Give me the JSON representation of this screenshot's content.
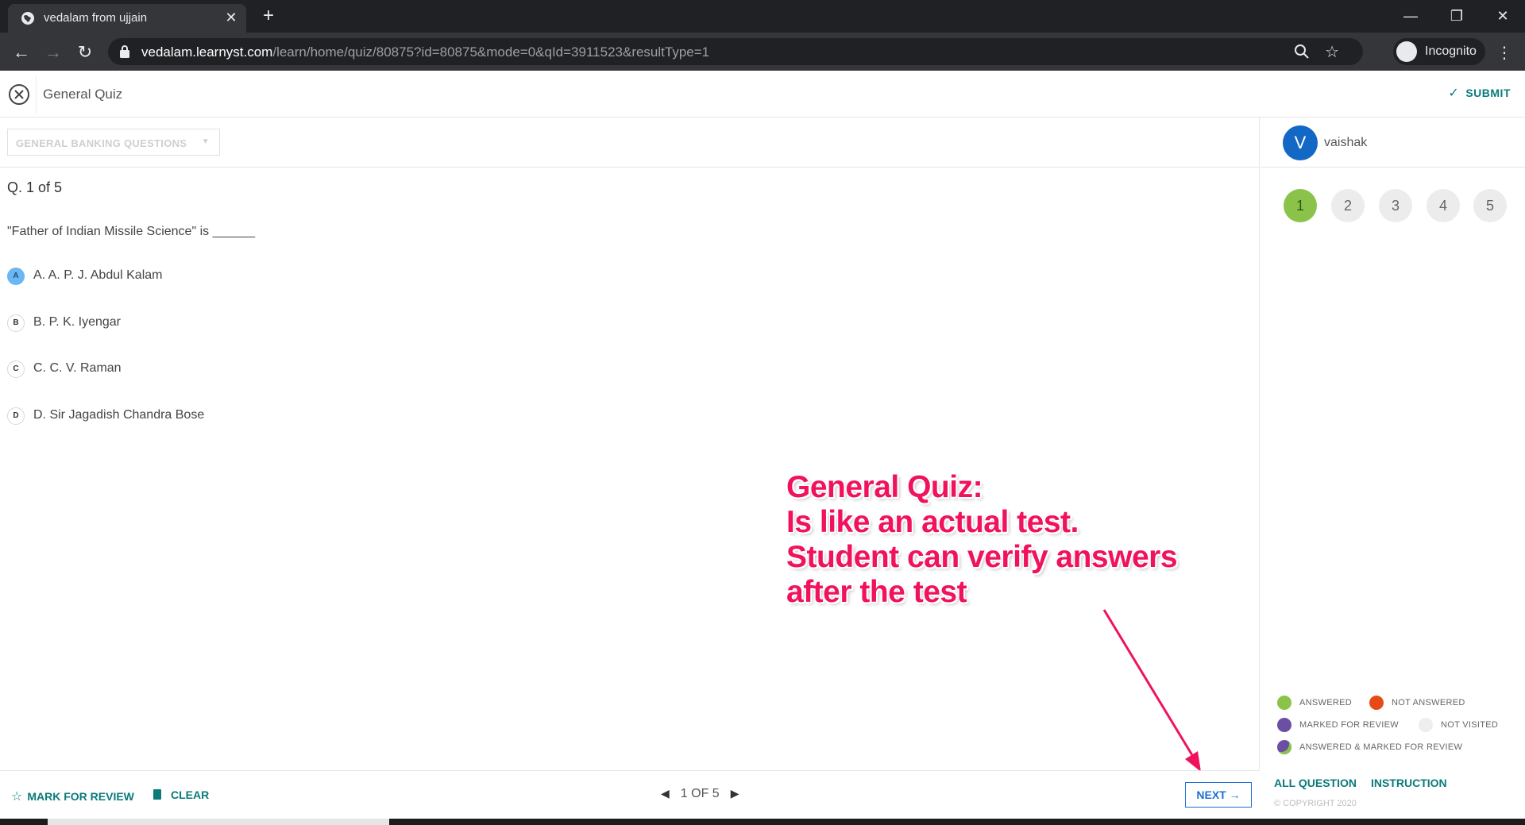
{
  "browser": {
    "tab_title": "vedalam from ujjain",
    "url_host": "vedalam.learnyst.com",
    "url_path": "/learn/home/quiz/80875?id=80875&mode=0&qId=3911523&resultType=1",
    "incognito_label": "Incognito"
  },
  "header": {
    "quiz_title": "General Quiz",
    "submit_label": "SUBMIT"
  },
  "section": {
    "selected": "GENERAL BANKING QUESTIONS"
  },
  "question": {
    "counter": "Q. 1 of 5",
    "text": "\"Father of Indian Missile Science\" is ______",
    "options": [
      {
        "letter": "A",
        "text": "A. A. P. J. Abdul Kalam",
        "selected": true
      },
      {
        "letter": "B",
        "text": "B. P. K. Iyengar",
        "selected": false
      },
      {
        "letter": "C",
        "text": "C. C. V. Raman",
        "selected": false
      },
      {
        "letter": "D",
        "text": "D. Sir Jagadish Chandra Bose",
        "selected": false
      }
    ]
  },
  "annotation": {
    "lines": [
      "General Quiz:",
      "Is like an actual test.",
      "Student can verify answers",
      "after the test"
    ],
    "color": "#f0125e"
  },
  "footer": {
    "mark_review_label": "MARK FOR REVIEW",
    "clear_label": "CLEAR",
    "pager_label": "1 OF 5",
    "next_label": "NEXT"
  },
  "sidebar": {
    "avatar_letter": "V",
    "user_name": "vaishak",
    "questions": [
      {
        "label": "1",
        "status": "answered"
      },
      {
        "label": "2",
        "status": "not-visited"
      },
      {
        "label": "3",
        "status": "not-visited"
      },
      {
        "label": "4",
        "status": "not-visited"
      },
      {
        "label": "5",
        "status": "not-visited"
      }
    ],
    "legend": {
      "answered": "ANSWERED",
      "not_answered": "NOT ANSWERED",
      "marked_for_review": "MARKED FOR REVIEW",
      "not_visited": "NOT VISITED",
      "answered_marked": "ANSWERED & MARKED FOR REVIEW"
    },
    "colors": {
      "answered": "#8bc34a",
      "not_answered": "#e64a19",
      "marked": "#6a4fa3",
      "not_visited": "#eeeeee",
      "accent": "#0a7a7a"
    },
    "all_question_label": "ALL QUESTION",
    "instruction_label": "INSTRUCTION",
    "copyright": "© COPYRIGHT 2020"
  }
}
